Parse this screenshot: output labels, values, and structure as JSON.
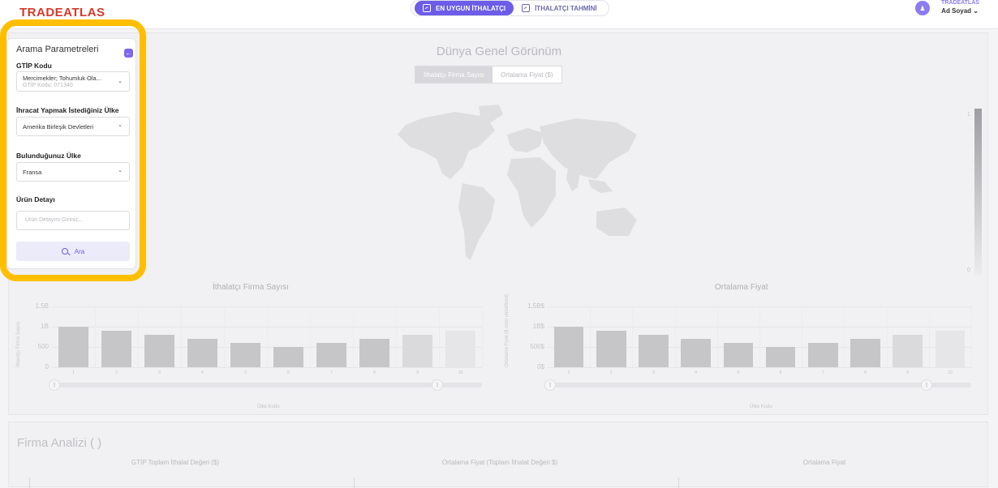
{
  "header": {
    "logo": "TRADEATLAS",
    "tabs": [
      {
        "label": "EN UYGUN İTHALATÇI",
        "active": true
      },
      {
        "label": "İTHALATÇI TAHMİNİ",
        "active": false
      }
    ],
    "user": {
      "company": "TRADEATLAS",
      "name": "Ad Soyad ⌄"
    }
  },
  "sidebar": {
    "title": "Arama Parametreleri",
    "gtip_label": "GTİP Kodu",
    "gtip_value": "Mercimekler; Tohumluk Ola...",
    "gtip_sub": "GTİP Kodu: 071340",
    "export_label": "İhracat Yapmak İstediğiniz Ülke",
    "export_value": "Amerika Birleşik Devletleri",
    "location_label": "Bulunduğunuz Ülke",
    "location_value": "Fransa",
    "detail_label": "Ürün Detayı",
    "detail_placeholder": "Ürün Detayını Giriniz...",
    "search_label": "Ara"
  },
  "overview": {
    "title": "Dünya Genel Görünüm",
    "segments": [
      "İthalatçı Firma Sayısı",
      "Ortalama Fiyat ($)"
    ],
    "scale_max": "1",
    "scale_min": "0"
  },
  "charts": {
    "left": {
      "title": "İthalatçı Firma Sayısı",
      "ylabel": "İthalatçı Firma Sayısı",
      "xlabel": "Ülke Kodu",
      "yticks": [
        "1,5B",
        "1B",
        "500",
        "0"
      ]
    },
    "right": {
      "title": "Ortalama Fiyat",
      "ylabel": "Ortalama Fiyat ($ cinsi undefined)",
      "xlabel": "Ülke Kodu",
      "yticks": [
        "1,5B$",
        "1B$",
        "500$",
        "0$"
      ]
    }
  },
  "chart_data": [
    {
      "type": "bar",
      "title": "İthalatçı Firma Sayısı",
      "xlabel": "Ülke Kodu",
      "ylabel": "İthalatçı Firma Sayısı",
      "categories": [
        "1",
        "2",
        "3",
        "4",
        "5",
        "6",
        "7",
        "8",
        "9",
        "10"
      ],
      "values": [
        1000,
        900,
        800,
        700,
        600,
        500,
        600,
        700,
        800,
        900
      ],
      "ylim": [
        0,
        1500
      ]
    },
    {
      "type": "bar",
      "title": "Ortalama Fiyat",
      "xlabel": "Ülke Kodu",
      "ylabel": "Ortalama Fiyat ($ cinsi undefined)",
      "categories": [
        "1",
        "2",
        "3",
        "4",
        "5",
        "6",
        "7",
        "8",
        "9",
        "10"
      ],
      "values": [
        1000,
        900,
        800,
        700,
        600,
        500,
        600,
        700,
        800,
        900
      ],
      "ylim": [
        0,
        1500
      ]
    }
  ],
  "firma": {
    "title": "Firma Analizi ( )",
    "columns": [
      "GTİP Toplam İthalat Değeri ($)",
      "Ortalama Fiyat (Toplam İthalat Değeri $)",
      "Ortalama Fiyat"
    ]
  },
  "colors": {
    "accent": "#6c5ce7",
    "highlight": "#ffbf00",
    "brand": "#d23a2a"
  }
}
